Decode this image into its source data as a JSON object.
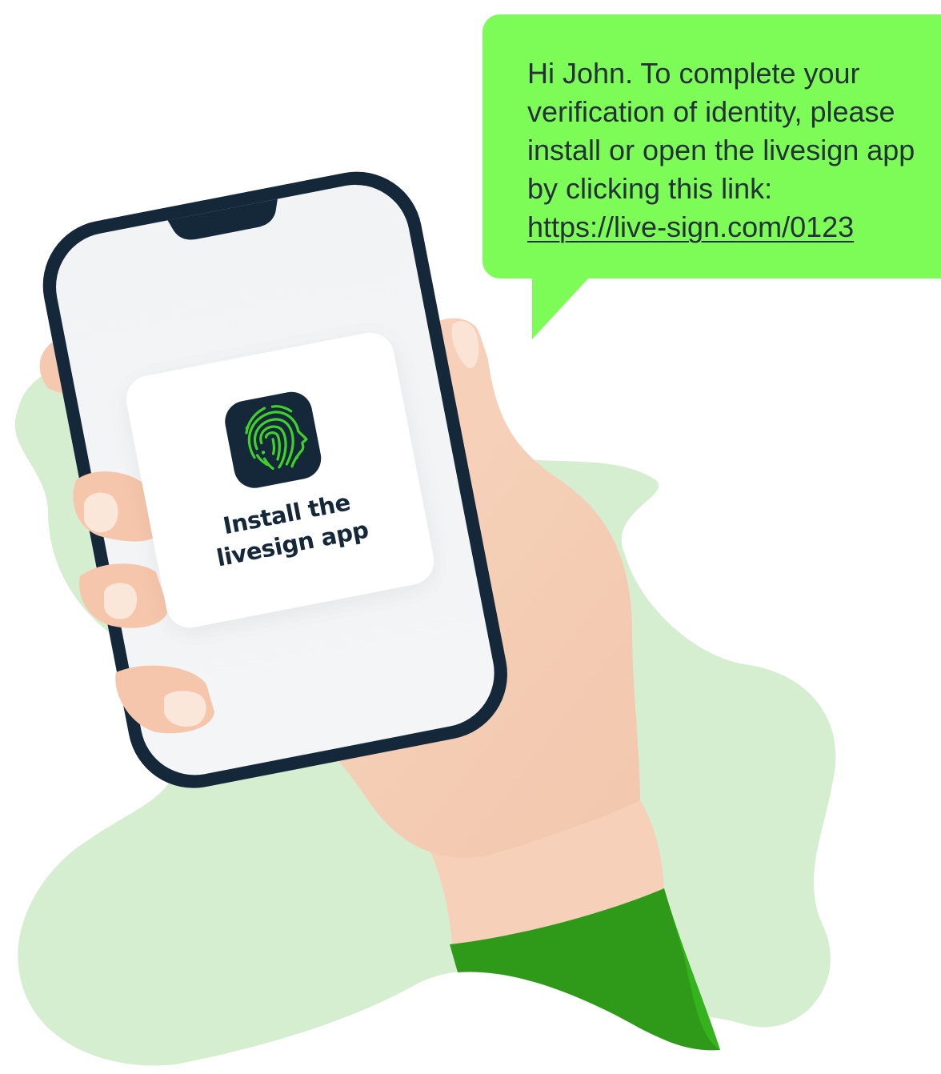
{
  "sms": {
    "lines": [
      "Hi John. To complete your",
      "verification of identity, please",
      "install or open the livesign app",
      "by clicking this link:"
    ],
    "link": "https://live-sign.com/0123"
  },
  "app_card": {
    "line1": "Install the",
    "line2": "livesign app",
    "icon": "fingerprint-face-icon"
  },
  "colors": {
    "bubble": "#7dfc58",
    "blob": "#d5eed0",
    "phone_frame": "#15283a",
    "skin": "#f6d0b8",
    "sleeve": "#2f9a1a",
    "icon_bg": "#15283a",
    "icon_green": "#3fd12a"
  }
}
